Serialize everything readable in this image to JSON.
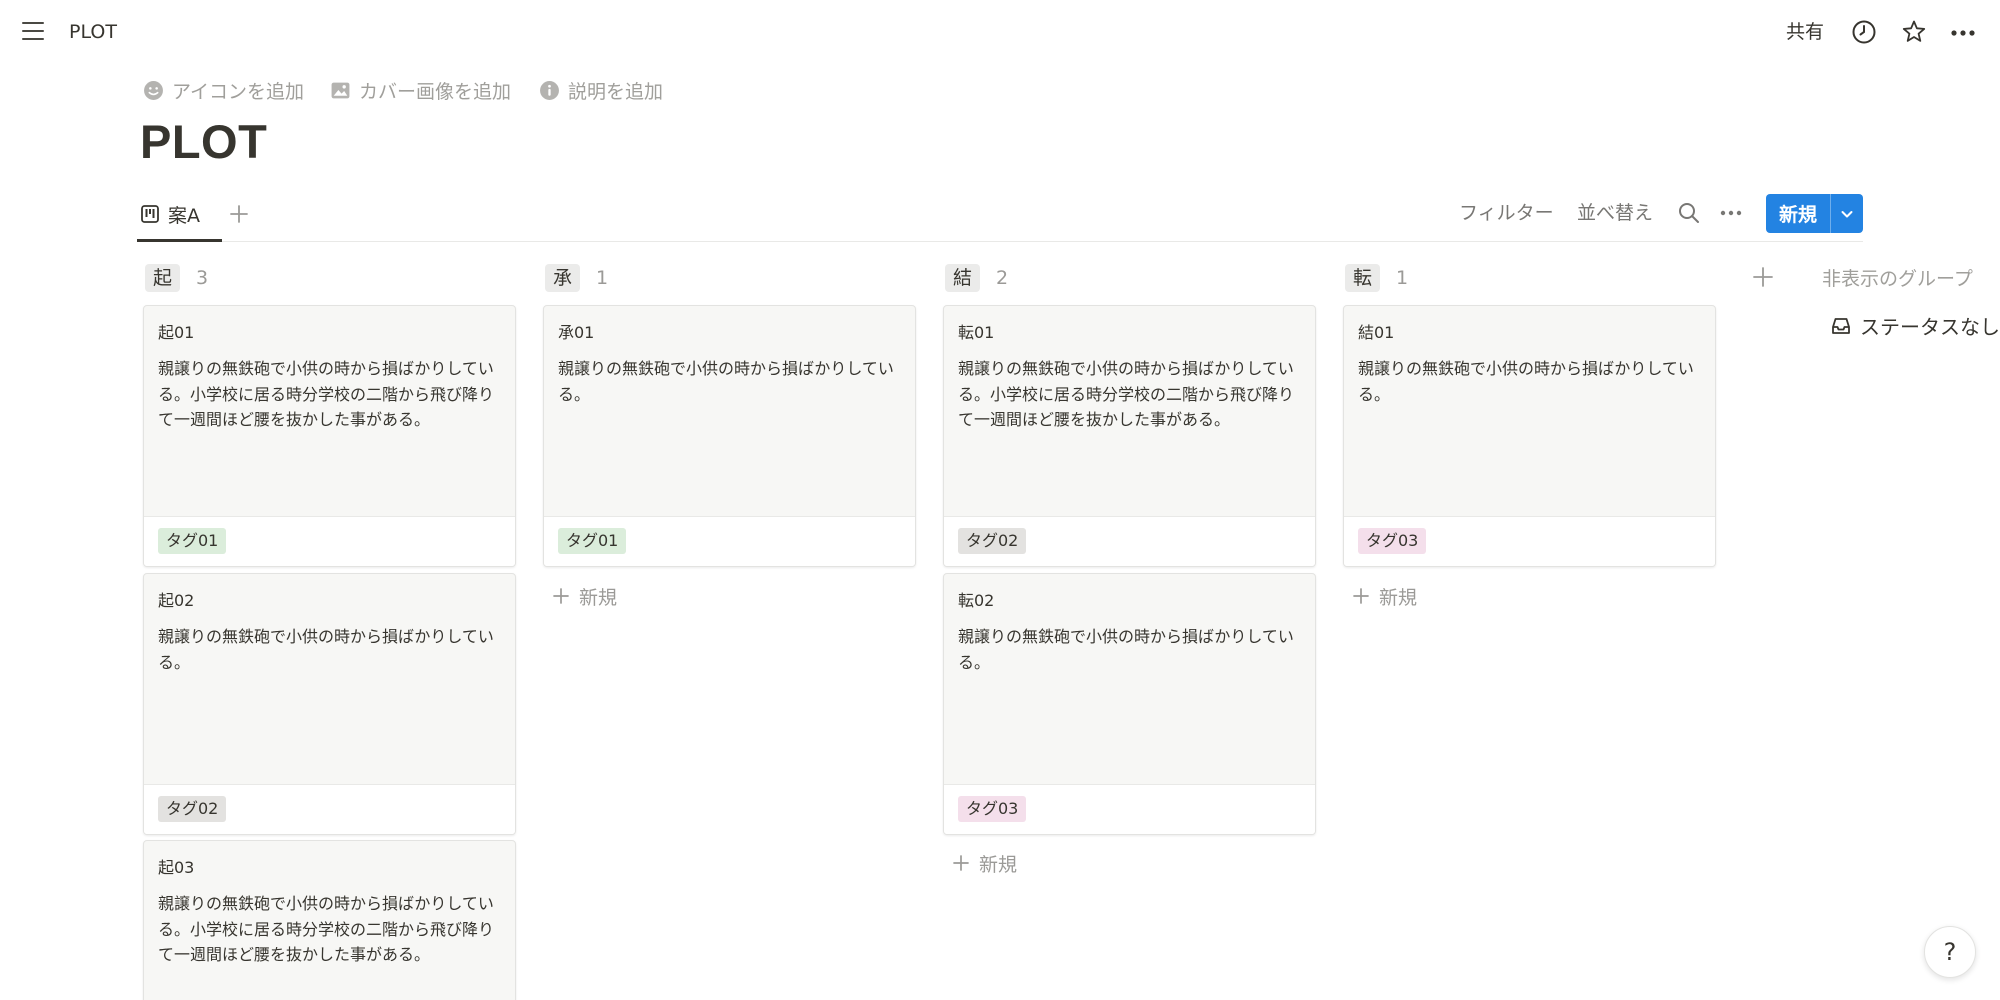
{
  "topbar": {
    "page_name": "PLOT",
    "share_label": "共有",
    "icons": [
      "menu-icon",
      "clock-icon",
      "star-icon",
      "more-icon"
    ]
  },
  "page": {
    "actions": [
      {
        "label": "アイコンを追加",
        "icon": "smiley-icon"
      },
      {
        "label": "カバー画像を追加",
        "icon": "image-icon"
      },
      {
        "label": "説明を追加",
        "icon": "info-icon"
      }
    ],
    "title": "PLOT"
  },
  "views": {
    "tabs": [
      {
        "label": "案A",
        "icon": "board-icon"
      }
    ]
  },
  "toolbar": {
    "filter_label": "フィルター",
    "sort_label": "並べ替え",
    "new_label": "新規",
    "brand_color": "#2383e2"
  },
  "board": {
    "groups": [
      {
        "name": "起",
        "count": "3",
        "cards": [
          {
            "title": "起01",
            "body": "親譲りの無鉄砲で小供の時から損ばかりしている。小学校に居る時分学校の二階から飛び降りて一週間ほど腰を抜かした事がある。",
            "tag": "タグ01",
            "tag_color": "#dbeddb"
          },
          {
            "title": "起02",
            "body": "親譲りの無鉄砲で小供の時から損ばかりしている。",
            "tag": "タグ02",
            "tag_color": "#e3e2e0"
          },
          {
            "title": "起03",
            "body": "親譲りの無鉄砲で小供の時から損ばかりしている。小学校に居る時分学校の二階から飛び降りて一週間ほど腰を抜かした事がある。",
            "tag": "",
            "tag_color": ""
          }
        ]
      },
      {
        "name": "承",
        "count": "1",
        "cards": [
          {
            "title": "承01",
            "body": "親譲りの無鉄砲で小供の時から損ばかりしている。",
            "tag": "タグ01",
            "tag_color": "#dbeddb"
          }
        ],
        "new_label": "新規"
      },
      {
        "name": "結",
        "count": "2",
        "cards": [
          {
            "title": "転01",
            "body": "親譲りの無鉄砲で小供の時から損ばかりしている。小学校に居る時分学校の二階から飛び降りて一週間ほど腰を抜かした事がある。",
            "tag": "タグ02",
            "tag_color": "#e3e2e0"
          },
          {
            "title": "転02",
            "body": "親譲りの無鉄砲で小供の時から損ばかりしている。",
            "tag": "タグ03",
            "tag_color": "#f4dfeb"
          }
        ],
        "new_label": "新規"
      },
      {
        "name": "転",
        "count": "1",
        "cards": [
          {
            "title": "結01",
            "body": "親譲りの無鉄砲で小供の時から損ばかりしている。",
            "tag": "タグ03",
            "tag_color": "#f4dfeb"
          }
        ],
        "new_label": "新規"
      }
    ],
    "hidden_groups_label": "非表示のグループ",
    "no_status_label": "ステータスなし"
  },
  "help_label": "?"
}
